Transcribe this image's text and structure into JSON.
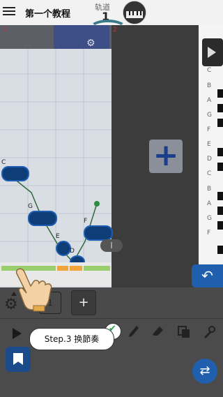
{
  "header": {
    "title": "第一个教程",
    "track_label": "轨道",
    "track_number": "1"
  },
  "editor": {
    "marker_left": "1",
    "marker_right": "2",
    "notes": [
      {
        "label": "C"
      },
      {
        "label": "G"
      },
      {
        "label": "E"
      },
      {
        "label": "D"
      },
      {
        "label": "F"
      }
    ],
    "slider_label": "I"
  },
  "piano_keys": [
    "C",
    "B",
    "A",
    "G",
    "F",
    "E",
    "D",
    "C",
    "B",
    "A",
    "G",
    "F"
  ],
  "buttons": {
    "add_pattern": "+",
    "add_track": "+",
    "small_box": "1",
    "back": "↶",
    "swap": "⇄"
  },
  "tutorial": {
    "step_text": "Step.3 换節奏"
  },
  "colors": {
    "accent_blue": "#1f5fae",
    "note_fill": "#0e3d78",
    "beat_green": "#9acd6b",
    "beat_orange": "#f0a43a"
  }
}
